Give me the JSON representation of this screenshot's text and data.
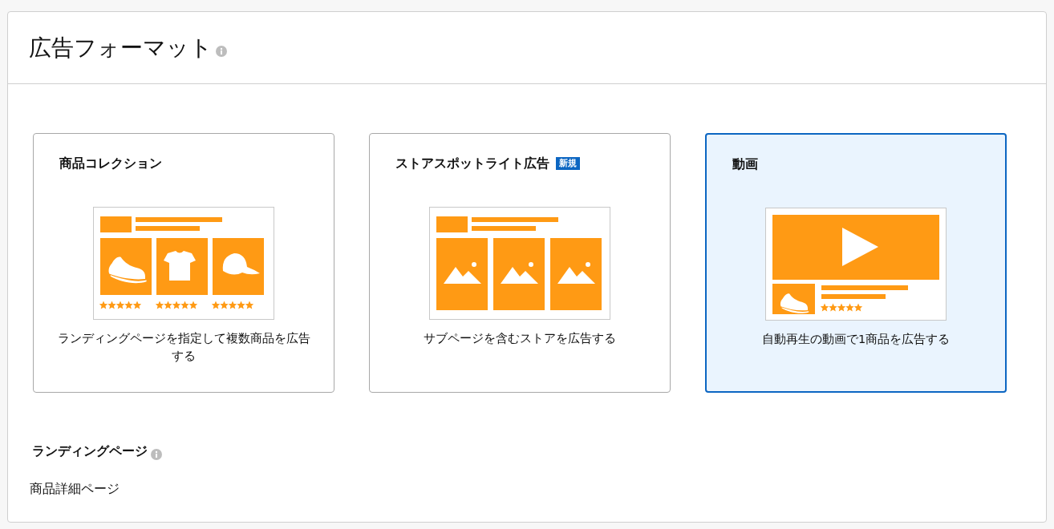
{
  "section": {
    "title": "広告フォーマット"
  },
  "formats": [
    {
      "kind": "collection",
      "title": "商品コレクション",
      "description": "ランディングページを指定して複数商品を広告する",
      "selected": false
    },
    {
      "kind": "store",
      "title": "ストアスポットライト広告",
      "badge": "新規",
      "description": "サブページを含むストアを広告する",
      "selected": false
    },
    {
      "kind": "video",
      "title": "動画",
      "description": "自動再生の動画で1商品を広告する",
      "selected": true
    }
  ],
  "landing_page": {
    "label": "ランディングページ",
    "value": "商品詳細ページ"
  }
}
